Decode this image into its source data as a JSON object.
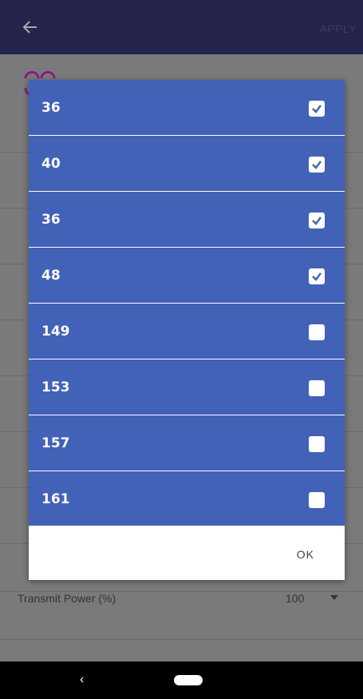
{
  "header": {
    "apply_label": "APPLY"
  },
  "dialog": {
    "items": [
      {
        "label": "36",
        "checked": true
      },
      {
        "label": "40",
        "checked": true
      },
      {
        "label": "36",
        "checked": true
      },
      {
        "label": "48",
        "checked": true
      },
      {
        "label": "149",
        "checked": false
      },
      {
        "label": "153",
        "checked": false
      },
      {
        "label": "157",
        "checked": false
      },
      {
        "label": "161",
        "checked": false
      }
    ],
    "ok_label": "OK"
  },
  "background": {
    "transmit_power_label": "Transmit Power (%)",
    "transmit_power_value": "100"
  }
}
